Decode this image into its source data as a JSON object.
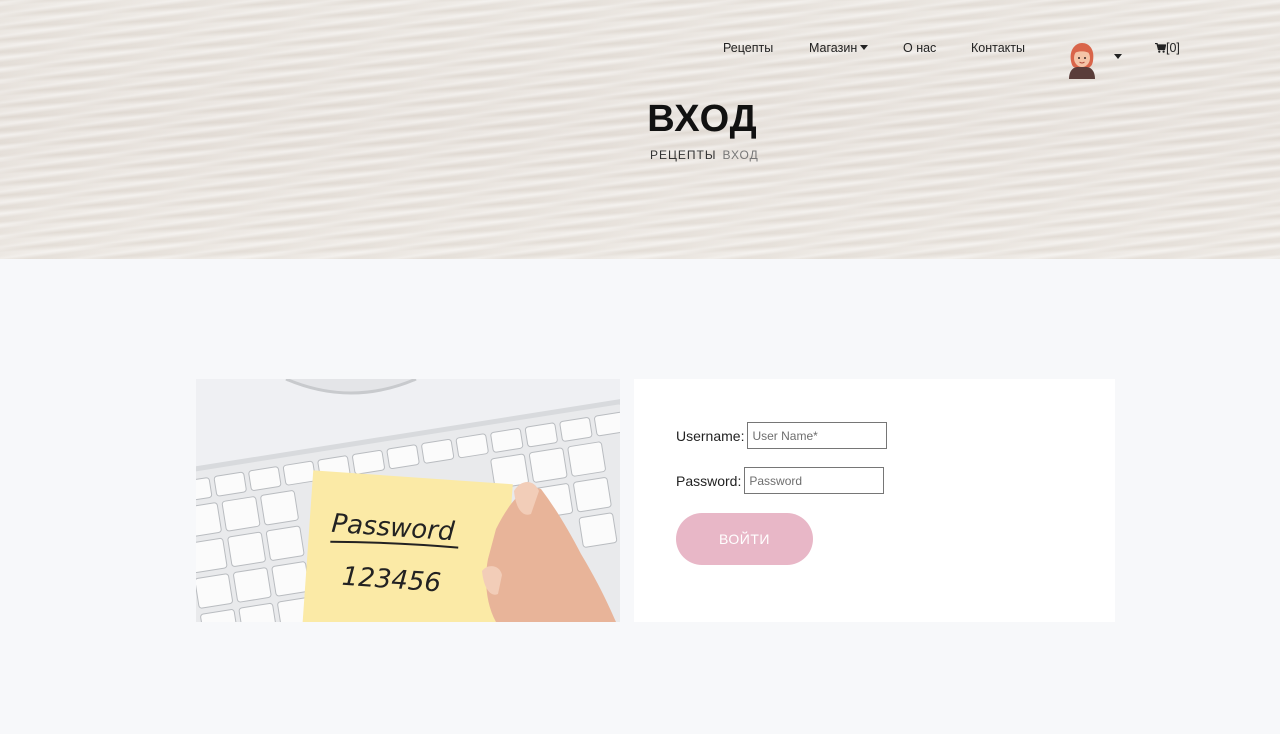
{
  "nav": {
    "items": [
      {
        "label": "Рецепты"
      },
      {
        "label": "Магазин"
      },
      {
        "label": "О нас"
      },
      {
        "label": "Контакты"
      }
    ],
    "cart_label": "[0]"
  },
  "hero": {
    "title": "ВХОД",
    "breadcrumb": [
      "РЕЦЕПТЫ",
      "ВХОД"
    ]
  },
  "image": {
    "note_title": "Password",
    "note_value": "123456"
  },
  "login_form": {
    "username_label": "Username:",
    "username_placeholder": "User Name*",
    "password_label": "Password:",
    "password_placeholder": "Password",
    "submit_label": "ВОЙТИ"
  },
  "colors": {
    "button": "#e8b7c7",
    "page_bg": "#f7f8fa",
    "form_bg": "#ffffff"
  },
  "icons": [
    "user-avatar-icon",
    "caret-down-icon",
    "cart-icon"
  ]
}
